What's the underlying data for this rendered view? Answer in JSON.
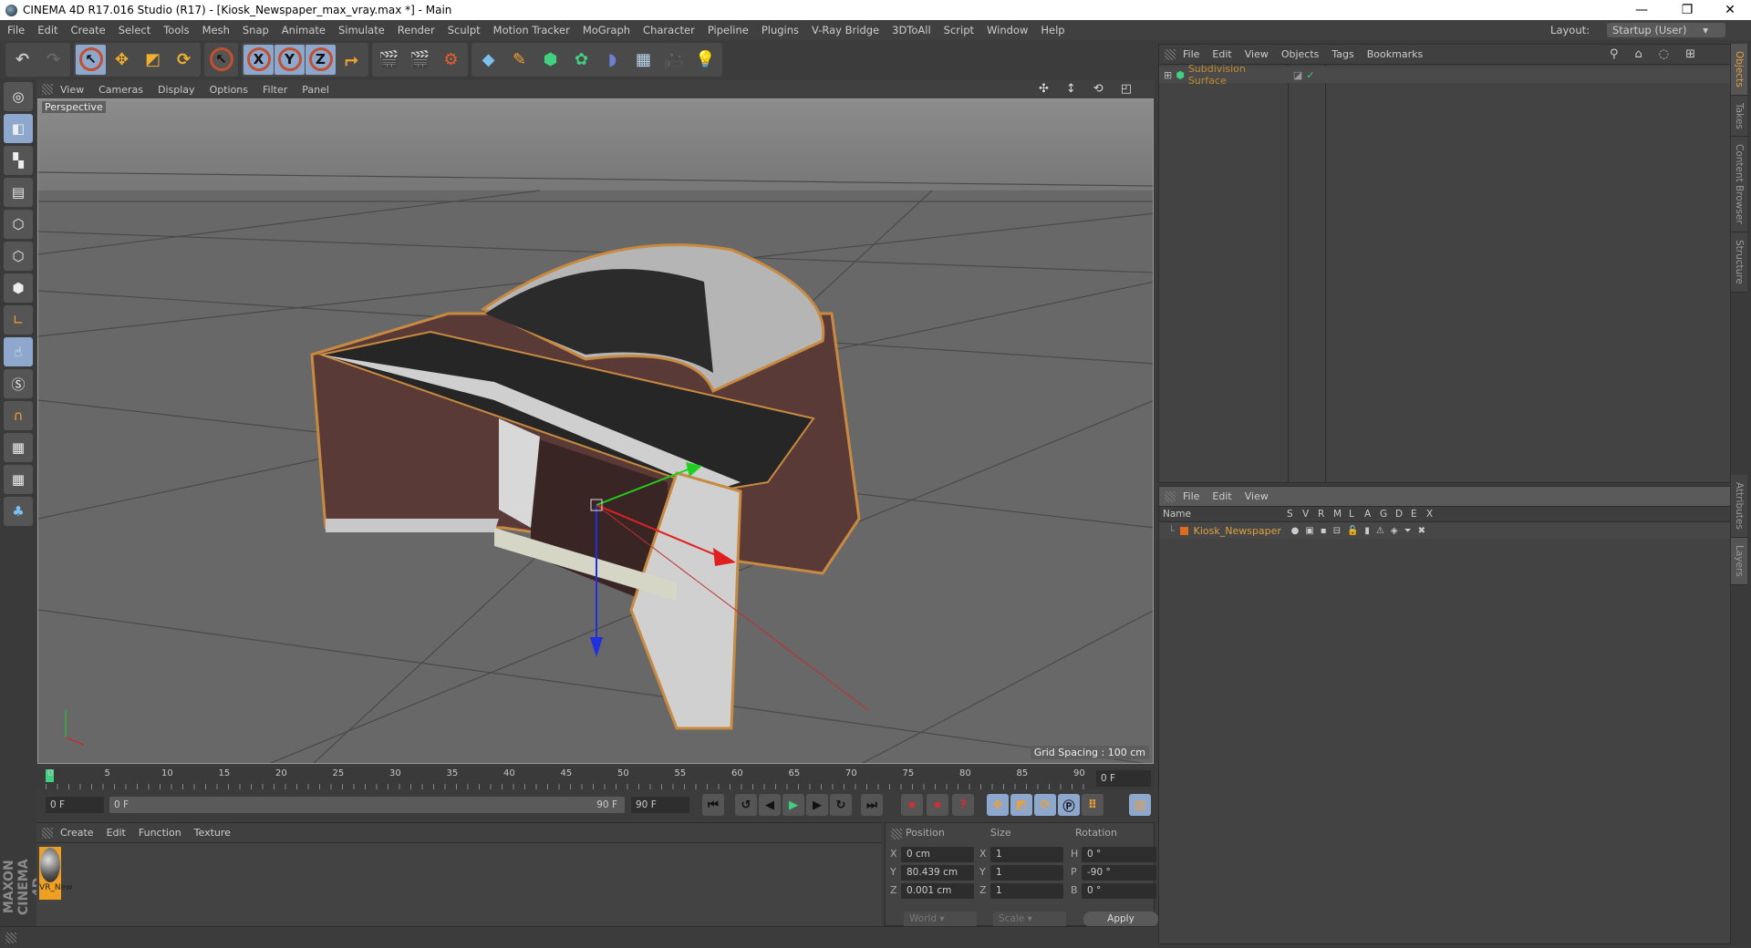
{
  "title": "CINEMA 4D R17.016 Studio (R17) - [Kiosk_Newspaper_max_vray.max *] - Main",
  "window_controls": [
    "—",
    "❐",
    "✕"
  ],
  "menu": [
    "File",
    "Edit",
    "Create",
    "Select",
    "Tools",
    "Mesh",
    "Snap",
    "Animate",
    "Simulate",
    "Render",
    "Sculpt",
    "Motion Tracker",
    "MoGraph",
    "Character",
    "Pipeline",
    "Plugins",
    "V-Ray Bridge",
    "3DToAll",
    "Script",
    "Window",
    "Help"
  ],
  "layout": {
    "label": "Layout:",
    "value": "Startup (User)"
  },
  "toolbar": {
    "axis": [
      "X",
      "Y",
      "Z"
    ]
  },
  "viewport": {
    "menu": [
      "View",
      "Cameras",
      "Display",
      "Options",
      "Filter",
      "Panel"
    ],
    "label": "Perspective",
    "grid_spacing": "Grid Spacing : 100 cm"
  },
  "objects_panel": {
    "menu": [
      "File",
      "Edit",
      "View",
      "Objects",
      "Tags",
      "Bookmarks"
    ],
    "items": [
      {
        "name": "Subdivision Surface"
      }
    ]
  },
  "layers_panel": {
    "menu": [
      "File",
      "Edit",
      "View"
    ],
    "columns": [
      "Name",
      "S",
      "V",
      "R",
      "M",
      "L",
      "A",
      "G",
      "D",
      "E",
      "X"
    ],
    "items": [
      {
        "name": "Kiosk_Newspaper",
        "color": "#e06a20"
      }
    ]
  },
  "side_tabs": [
    "Objects",
    "Takes",
    "Content Browser",
    "Structure",
    "Attributes",
    "Layers"
  ],
  "timeline": {
    "ticks": [
      "0",
      "5",
      "10",
      "15",
      "20",
      "25",
      "30",
      "35",
      "40",
      "45",
      "50",
      "55",
      "60",
      "65",
      "70",
      "75",
      "80",
      "85",
      "90"
    ],
    "current_frame": "0 F",
    "progress": 0
  },
  "playback": {
    "start": "0 F",
    "range_start": "0 F",
    "range_end": "90 F",
    "end": "90 F"
  },
  "material_panel": {
    "menu": [
      "Create",
      "Edit",
      "Function",
      "Texture"
    ],
    "materials": [
      {
        "name": "VR_New"
      }
    ]
  },
  "coordinates": {
    "headers": [
      "Position",
      "Size",
      "Rotation"
    ],
    "rows": [
      {
        "axis": "X",
        "pos": "0 cm",
        "size_axis": "X",
        "size": "1",
        "rot_axis": "H",
        "rot": "0 °"
      },
      {
        "axis": "Y",
        "pos": "80.439 cm",
        "size_axis": "Y",
        "size": "1",
        "rot_axis": "P",
        "rot": "-90 °"
      },
      {
        "axis": "Z",
        "pos": "0.001 cm",
        "size_axis": "Z",
        "size": "1",
        "rot_axis": "B",
        "rot": "0 °"
      }
    ],
    "mode": "World",
    "size_mode": "Scale",
    "apply": "Apply"
  },
  "branding": "MAXON CINEMA 4D"
}
